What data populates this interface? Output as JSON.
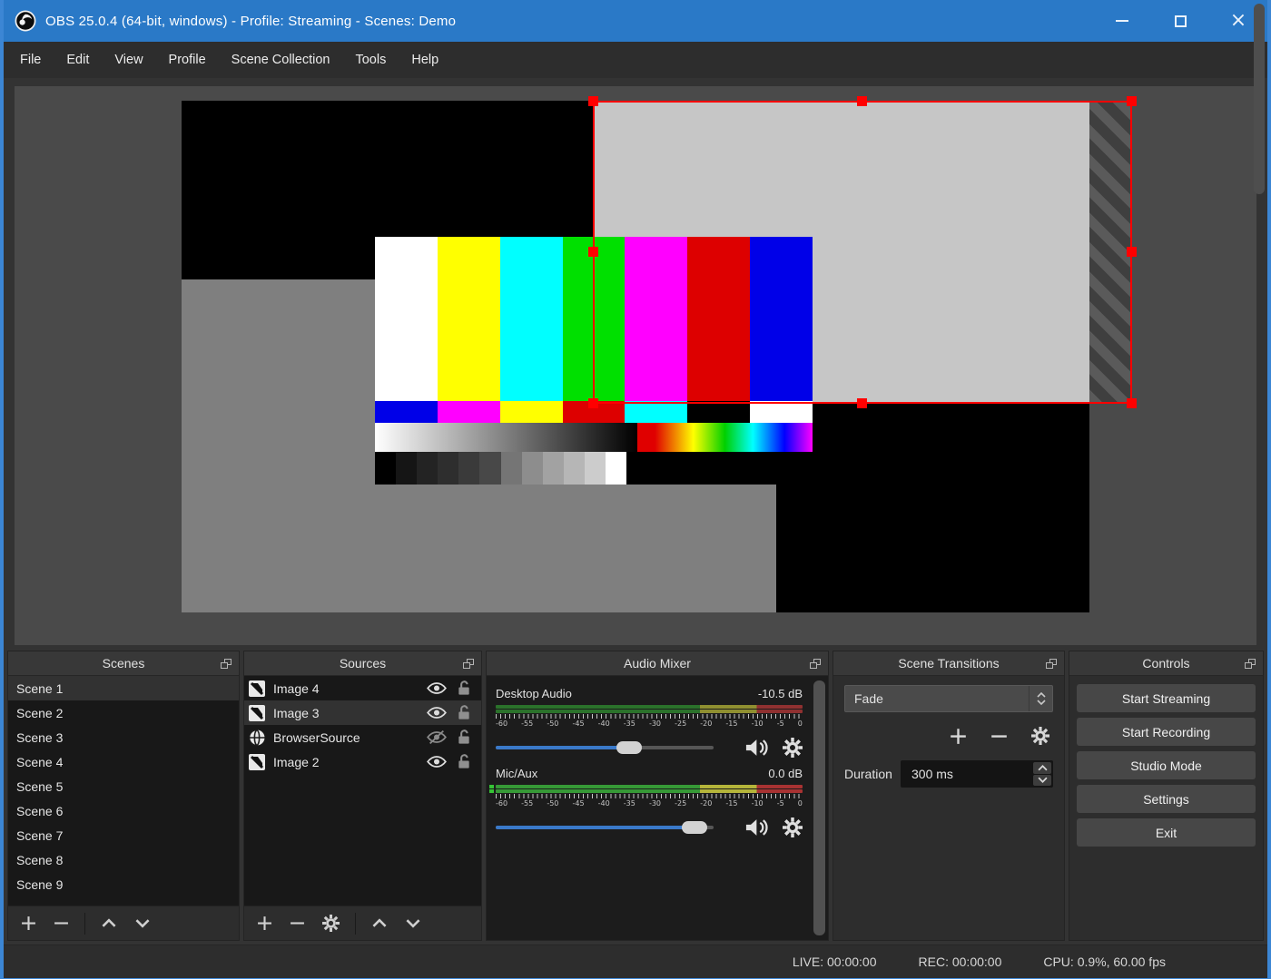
{
  "window": {
    "title": "OBS 25.0.4 (64-bit, windows) - Profile: Streaming - Scenes: Demo"
  },
  "menu": {
    "items": [
      "File",
      "Edit",
      "View",
      "Profile",
      "Scene Collection",
      "Tools",
      "Help"
    ]
  },
  "colors": {
    "titlebar_blue": "#2a79c7",
    "window_border_blue": "#3c86d4",
    "selection_red": "#ff0000",
    "slider_blue": "#3a79c9",
    "meter_green": "#369936",
    "meter_yellow": "#b5b53a",
    "meter_red": "#a83232",
    "canvas_light_gray_source": "#c6c6c6",
    "canvas_mid_gray": "#7f7f7f",
    "testcard_bars": [
      "#ffffff",
      "#ffff00",
      "#00ffff",
      "#00e000",
      "#ff00ff",
      "#dd0000",
      "#0000e8"
    ]
  },
  "panels": {
    "scenes": {
      "title": "Scenes",
      "items": [
        {
          "label": "Scene 1",
          "selected": true
        },
        {
          "label": "Scene 2"
        },
        {
          "label": "Scene 3"
        },
        {
          "label": "Scene 4"
        },
        {
          "label": "Scene 5"
        },
        {
          "label": "Scene 6"
        },
        {
          "label": "Scene 7"
        },
        {
          "label": "Scene 8"
        },
        {
          "label": "Scene 9"
        }
      ]
    },
    "sources": {
      "title": "Sources",
      "items": [
        {
          "name": "Image 4",
          "icon": "image",
          "visible": true,
          "locked": false
        },
        {
          "name": "Image 3",
          "icon": "image",
          "visible": true,
          "locked": false,
          "selected": true
        },
        {
          "name": "BrowserSource",
          "icon": "globe",
          "visible": false,
          "locked": false
        },
        {
          "name": "Image 2",
          "icon": "image",
          "visible": true,
          "locked": false
        }
      ]
    },
    "audio_mixer": {
      "title": "Audio Mixer",
      "scale": [
        "-60",
        "-55",
        "-50",
        "-45",
        "-40",
        "-35",
        "-30",
        "-25",
        "-20",
        "-15",
        "-10",
        "-5",
        "0"
      ],
      "channels": [
        {
          "name": "Desktop Audio",
          "level": "-10.5 dB",
          "slider_pct": 57
        },
        {
          "name": "Mic/Aux",
          "level": "0.0 dB",
          "slider_pct": 87
        }
      ]
    },
    "transitions": {
      "title": "Scene Transitions",
      "transition": "Fade",
      "duration_label": "Duration",
      "duration_value": "300 ms"
    },
    "controls": {
      "title": "Controls",
      "buttons": [
        "Start Streaming",
        "Start Recording",
        "Studio Mode",
        "Settings",
        "Exit"
      ]
    }
  },
  "status_bar": {
    "live": "LIVE: 00:00:00",
    "rec": "REC: 00:00:00",
    "cpu": "CPU: 0.9%, 60.00 fps"
  }
}
